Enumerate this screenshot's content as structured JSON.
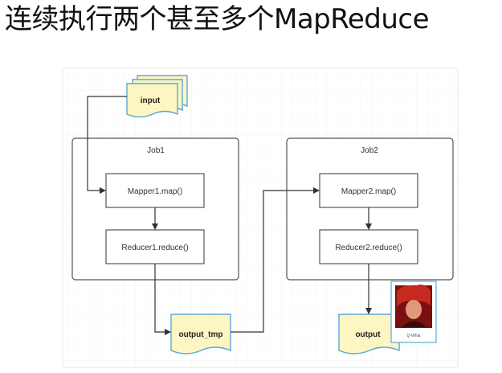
{
  "slide": {
    "title": "连续执行两个甚至多个MapReduce"
  },
  "diagram": {
    "input_label": "input",
    "job1": {
      "title": "Job1",
      "mapper": "Mapper1.map()",
      "reducer": "Reducer1.reduce()"
    },
    "job2": {
      "title": "Job2",
      "mapper": "Mapper2.map()",
      "reducer": "Reducer2.reduce()"
    },
    "temp_output_label": "output_tmp",
    "output_label": "output",
    "avatar": {
      "caption": "Q-Whla"
    }
  },
  "colors": {
    "doc_fill": "#fdf6c3",
    "doc_stroke": "#5aa8d8",
    "box_stroke": "#555555",
    "grid": "#e6e6e6",
    "arrow": "#333333"
  }
}
